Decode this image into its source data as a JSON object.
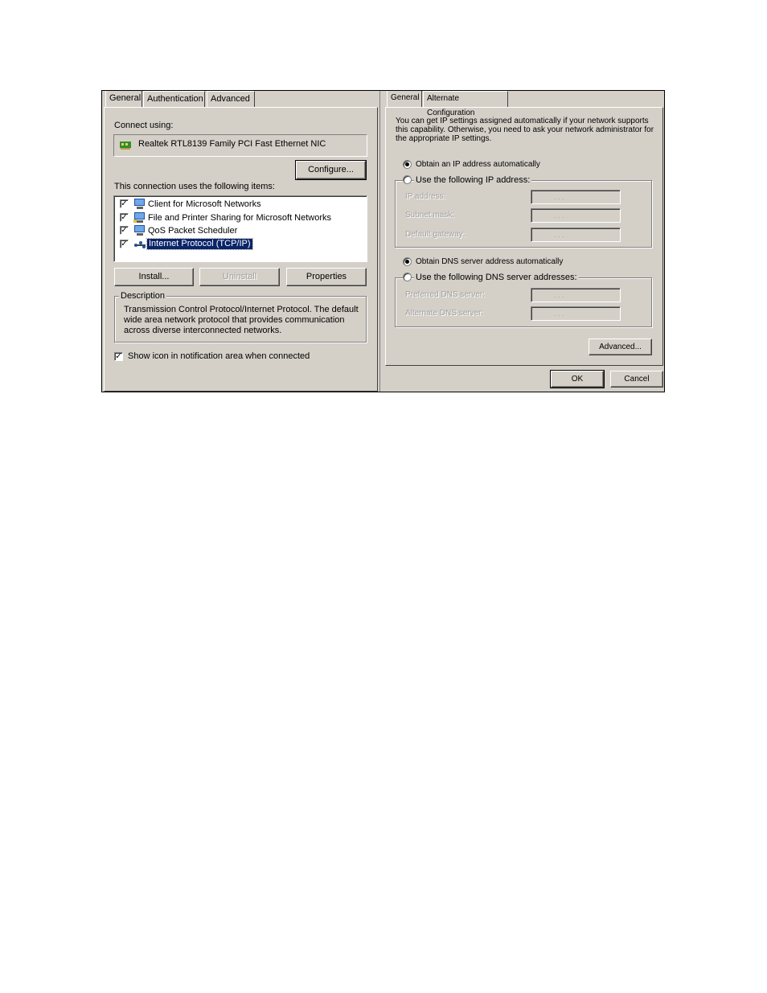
{
  "left_dialog": {
    "tabs": [
      "General",
      "Authentication",
      "Advanced"
    ],
    "connect_using_label": "Connect using:",
    "adapter_name": "Realtek RTL8139 Family PCI Fast Ethernet NIC",
    "configure_button": "Configure...",
    "items_label": "This connection uses the following items:",
    "items": [
      {
        "label": "Client for Microsoft Networks",
        "checked": true,
        "icon": "network-client-icon"
      },
      {
        "label": "File and Printer Sharing for Microsoft Networks",
        "checked": true,
        "icon": "file-printer-sharing-icon"
      },
      {
        "label": "QoS Packet Scheduler",
        "checked": true,
        "icon": "qos-scheduler-icon"
      },
      {
        "label": "Internet Protocol (TCP/IP)",
        "checked": true,
        "icon": "protocol-icon",
        "selected": true
      }
    ],
    "install_button": "Install...",
    "uninstall_button": "Uninstall",
    "properties_button": "Properties",
    "description_legend": "Description",
    "description_text_1": "Transmission Control Protocol/Internet Protocol. The default",
    "description_text_2": "wide area network protocol that provides communication",
    "description_text_3": "across diverse interconnected networks.",
    "show_icon_label": "Show icon in notification area when connected",
    "show_icon_checked": true
  },
  "right_dialog": {
    "tabs": [
      "General",
      "Alternate Configuration"
    ],
    "intro_1": "You can get IP settings assigned automatically if your network supports",
    "intro_2": "this capability. Otherwise, you need to ask your network administrator for",
    "intro_3": "the appropriate IP settings.",
    "obtain_ip_auto": "Obtain an IP address automatically",
    "use_following_ip": "Use the following IP address:",
    "ip_address_label": "IP address:",
    "subnet_mask_label": "Subnet mask:",
    "default_gateway_label": "Default gateway:",
    "obtain_dns_auto": "Obtain DNS server address automatically",
    "use_following_dns": "Use the following DNS server addresses:",
    "preferred_dns_label": "Preferred DNS server:",
    "alternate_dns_label": "Alternate DNS server:",
    "ip_dots": ".      .      .",
    "advanced_button": "Advanced...",
    "ok_button": "OK",
    "cancel_button": "Cancel"
  },
  "colors": {
    "dialog_bg": "#d4d0c8",
    "selection_bg": "#0a246a",
    "disabled_text": "#a0a0a0"
  }
}
